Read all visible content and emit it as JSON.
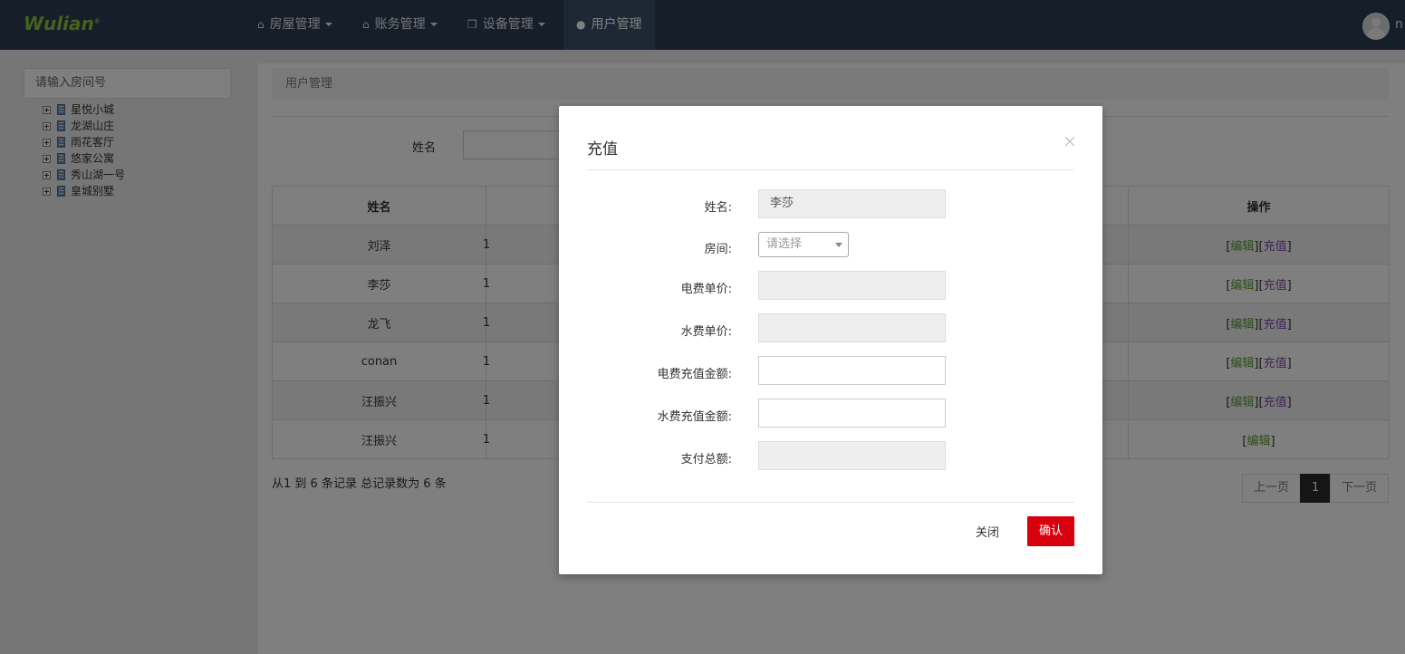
{
  "brand": {
    "logo": "Wulian",
    "logo_mark": "®"
  },
  "nav": [
    {
      "label": "房屋管理",
      "icon": "home-icon",
      "dropdown": true
    },
    {
      "label": "账务管理",
      "icon": "home-icon",
      "dropdown": true
    },
    {
      "label": "设备管理",
      "icon": "cubes-icon",
      "dropdown": true
    },
    {
      "label": "用户管理",
      "icon": "user-icon",
      "dropdown": false,
      "active": true
    }
  ],
  "user": {
    "name": "n"
  },
  "sidebar": {
    "search_placeholder": "请输入房间号",
    "tree": [
      "星悦小城",
      "龙湖山庄",
      "雨花客厅",
      "悠家公寓",
      "秀山湖一号",
      "皇城别墅"
    ]
  },
  "main": {
    "breadcrumb": "用户管理",
    "filter_label": "姓名",
    "table": {
      "headers": [
        "姓名",
        "",
        "操作"
      ],
      "rows": [
        {
          "name": "刘泽",
          "col2": "1",
          "edit": "编辑",
          "recharge": "充值"
        },
        {
          "name": "李莎",
          "col2": "1",
          "edit": "编辑",
          "recharge": "充值"
        },
        {
          "name": "龙飞",
          "col2": "1",
          "edit": "编辑",
          "recharge": "充值"
        },
        {
          "name": "conan",
          "col2": "1",
          "edit": "编辑",
          "recharge": "充值"
        },
        {
          "name": "汪振兴",
          "col2": "1",
          "edit": "编辑",
          "recharge": "充值"
        },
        {
          "name": "汪振兴",
          "col2": "1",
          "edit": "编辑",
          "recharge": ""
        }
      ]
    },
    "record_info": "从1 到 6 条记录 总记录数为 6 条",
    "pager": {
      "prev": "上一页",
      "current": "1",
      "next": "下一页"
    }
  },
  "modal": {
    "title": "充值",
    "close_icon": "×",
    "fields": {
      "name_label": "姓名:",
      "name_value": "李莎",
      "room_label": "房间:",
      "room_placeholder": "请选择",
      "elec_price_label": "电费单价:",
      "elec_price_value": "",
      "water_price_label": "水费单价:",
      "water_price_value": "",
      "elec_amount_label": "电费充值金额:",
      "elec_amount_value": "",
      "water_amount_label": "水费充值金额:",
      "water_amount_value": "",
      "total_label": "支付总额:",
      "total_value": ""
    },
    "close_label": "关闭",
    "confirm_label": "确认"
  },
  "colors": {
    "topbar": "#2c3e52",
    "accent": "#d9000d",
    "logo": "#8bc53f",
    "edit_link": "#5a9e2f",
    "recharge_link": "#7a4ea8"
  }
}
